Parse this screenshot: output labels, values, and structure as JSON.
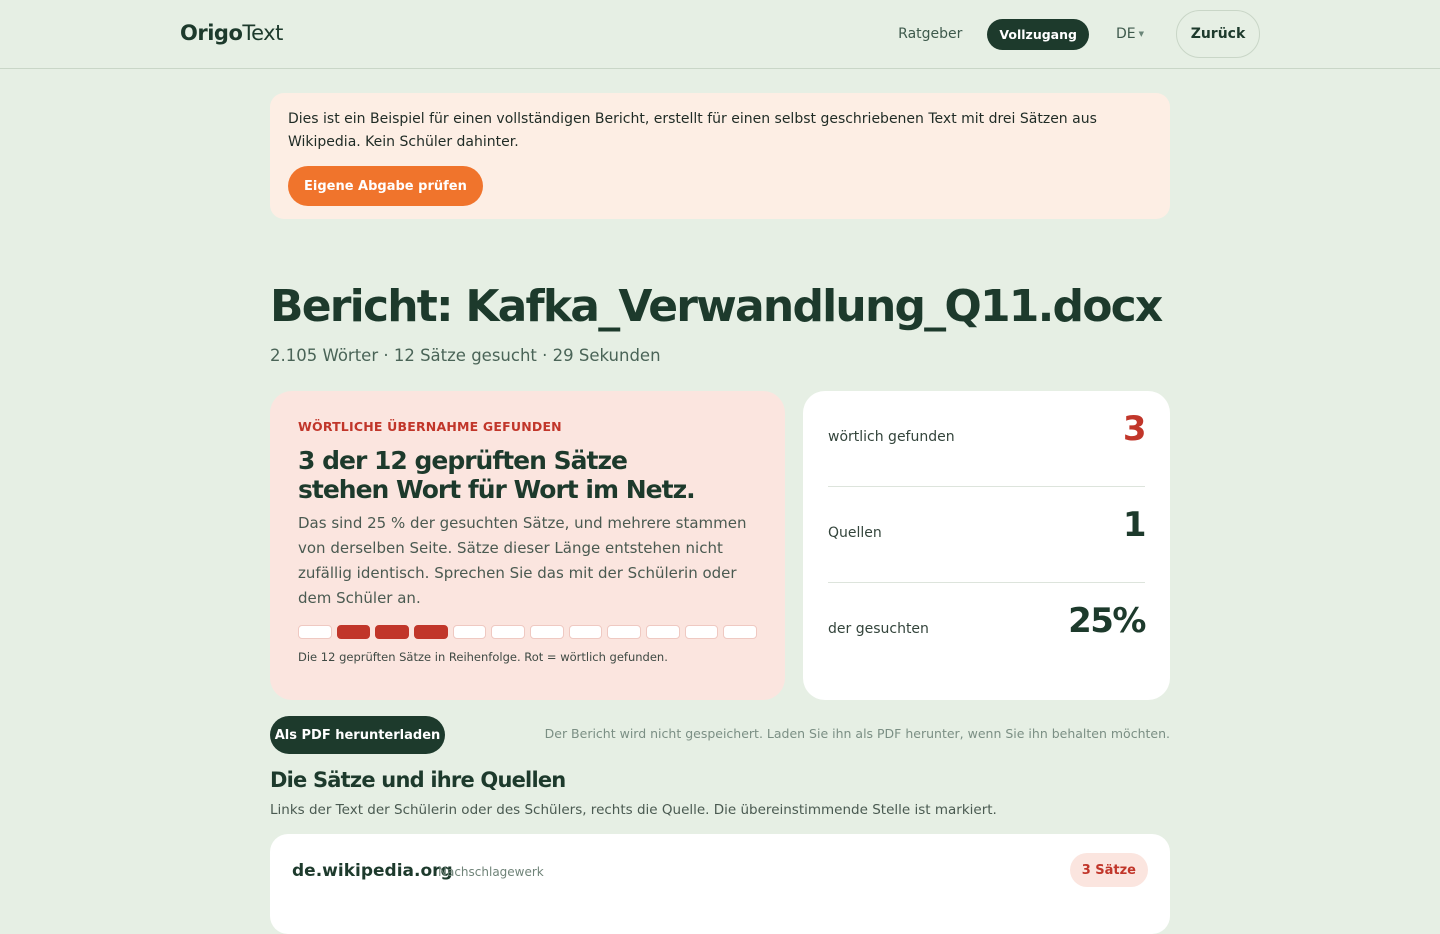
{
  "header": {
    "logo_part1": "Origo",
    "logo_part2": "Text",
    "nav_guide": "Ratgeber",
    "nav_full_access": "Vollzugang",
    "language": "DE",
    "back_label": "Zurück"
  },
  "notice": {
    "text": "Dies ist ein Beispiel für einen vollständigen Bericht, erstellt für einen selbst geschriebenen Text mit drei Sätzen aus Wikipedia. Kein Schüler dahinter.",
    "button_label": "Eigene Abgabe prüfen"
  },
  "report": {
    "title": "Bericht: Kafka_Verwandlung_Q11.docx",
    "meta": "2.105 Wörter · 12 Sätze gesucht · 29 Sekunden"
  },
  "result": {
    "eyebrow": "WÖRTLICHE ÜBERNAHME GEFUNDEN",
    "headline_line1": "3 der 12 geprüften Sätze",
    "headline_line2": "stehen Wort für Wort im Netz.",
    "description": "Das sind 25 % der gesuchten Sätze, und mehrere stammen von derselben Seite. Sätze dieser Länge entstehen nicht zufällig identisch. Sprechen Sie das mit der Schülerin oder dem Schüler an.",
    "sentence_flags": [
      false,
      true,
      true,
      true,
      false,
      false,
      false,
      false,
      false,
      false,
      false,
      false
    ],
    "bars_caption": "Die 12 geprüften Sätze in Reihenfolge. Rot = wörtlich gefunden.",
    "hit_color": "#c1362a"
  },
  "stats": [
    {
      "label": "wörtlich gefunden",
      "value": "3",
      "highlight": true
    },
    {
      "label": "Quellen",
      "value": "1",
      "highlight": false
    },
    {
      "label": "der gesuchten",
      "value": "25%",
      "highlight": false
    }
  ],
  "download": {
    "button_label": "Als PDF herunterladen",
    "note": "Der Bericht wird nicht gespeichert. Laden Sie ihn als PDF herunter, wenn Sie ihn behalten möchten."
  },
  "sources_section": {
    "title": "Die Sätze und ihre Quellen",
    "subtitle": "Links der Text der Schülerin oder des Schülers, rechts die Quelle. Die übereinstimmende Stelle ist markiert.",
    "items": [
      {
        "domain": "de.wikipedia.org",
        "type": "Nachschlagewerk",
        "badge": "3 Sätze"
      }
    ]
  },
  "colors": {
    "background": "#e6efe4",
    "brand_dark": "#1d3a2c",
    "accent_orange": "#f0742c",
    "alert_red": "#c1362a"
  }
}
